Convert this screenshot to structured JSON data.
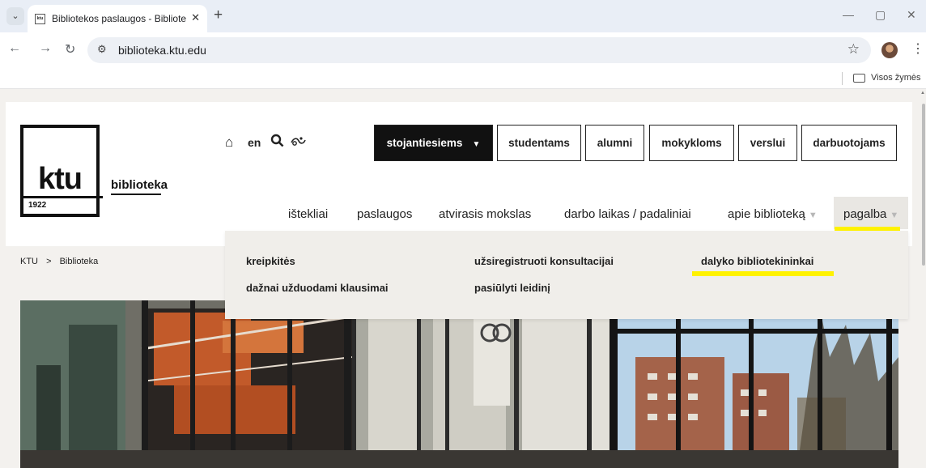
{
  "browser": {
    "tab_title": "Bibliotekos paslaugos - Bibliote",
    "tab_close": "✕",
    "new_tab": "+",
    "favicon_text": "ktu",
    "url": "biblioteka.ktu.edu",
    "bookmarks_folder": "Visos žymės",
    "icons": [
      "tab-search-icon",
      "back-icon",
      "forward-icon",
      "reload-icon",
      "site-settings-icon",
      "star-icon",
      "profile-avatar",
      "menu-icon",
      "minimize-icon",
      "maximize-icon",
      "close-icon",
      "folder-icon"
    ]
  },
  "logo": {
    "text": "ktu",
    "year": "1922",
    "subtitle": "biblioteka"
  },
  "utility": {
    "home_icon": "⌂",
    "lang": "en",
    "search_icon": "🔍",
    "accessibility_icon": "⚲"
  },
  "audience": [
    {
      "label": "stojantiesiems"
    },
    {
      "label": "studentams"
    },
    {
      "label": "alumni"
    },
    {
      "label": "mokykloms"
    },
    {
      "label": "verslui"
    },
    {
      "label": "darbuotojams"
    }
  ],
  "mainnav": [
    {
      "label": "ištekliai"
    },
    {
      "label": "paslaugos"
    },
    {
      "label": "atvirasis mokslas"
    },
    {
      "label": "darbo laikas / padaliniai"
    },
    {
      "label": "apie biblioteką"
    },
    {
      "label": "pagalba"
    }
  ],
  "breadcrumb": {
    "home": "KTU",
    "sep": ">",
    "current": "Biblioteka"
  },
  "dropdown": [
    {
      "label": "kreipkitės"
    },
    {
      "label": "dažnai užduodami klausimai"
    },
    {
      "label": "užsiregistruoti konsultacijai"
    },
    {
      "label": "pasiūlyti leidinį"
    },
    {
      "label": "dalyko bibliotekininkai"
    }
  ],
  "colors": {
    "highlight": "#fff200",
    "dark_button": "#111111",
    "page_bg": "#f3f1ee",
    "dropdown_bg": "#f0eeea"
  }
}
